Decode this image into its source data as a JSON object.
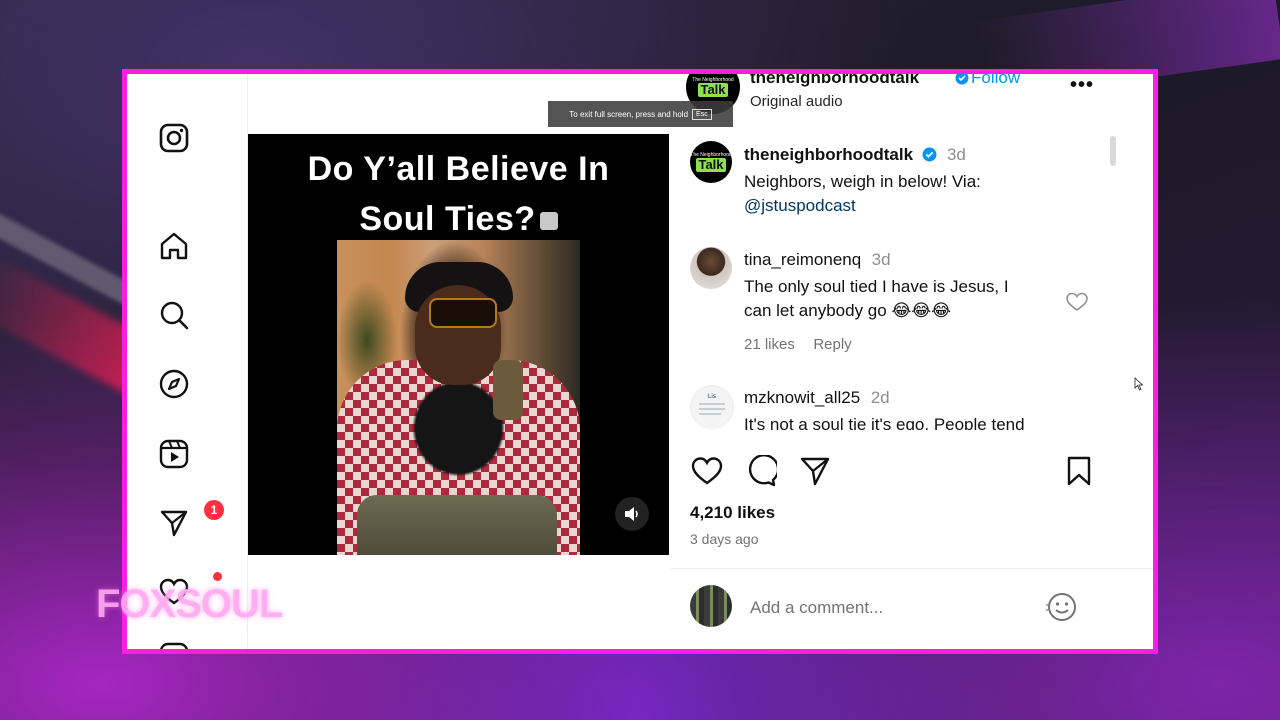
{
  "post": {
    "username": "theneighborhoodtalk",
    "follow_label": "Follow",
    "audio": "Original audio",
    "more_label": "•••",
    "fullscreen_tip": "To exit full screen, press and hold",
    "esc_key": "Esc",
    "avatar_logo_small": "The Neighborhood",
    "avatar_logo_big": "Talk"
  },
  "media": {
    "title_line1": "Do Y’all Believe In",
    "title_line2": "Soul Ties?"
  },
  "caption": {
    "username": "theneighborhoodtalk",
    "time": "3d",
    "text": "Neighbors, weigh in below! Via:",
    "mention": "@jstuspodcast"
  },
  "comments": [
    {
      "username": "tina_reimonenq",
      "time": "3d",
      "text_line1": "The only soul tied I have is Jesus, I",
      "text_line2": "can let anybody go 😂😂😂",
      "likes": "21 likes",
      "reply": "Reply"
    },
    {
      "username": "mzknowit_all25",
      "time": "2d",
      "text_line1": "It's not a soul tie it's ego. People tend"
    }
  ],
  "stats": {
    "likes": "4,210 likes",
    "posted": "3 days ago"
  },
  "composer": {
    "placeholder": "Add a comment..."
  },
  "nav": {
    "messages_badge": "1"
  },
  "watermark": "FOXSOUL",
  "colors": {
    "frame_border": "#ff1ce8",
    "follow": "#0095f6",
    "badge": "#ff3040",
    "verified": "#0095f6"
  }
}
